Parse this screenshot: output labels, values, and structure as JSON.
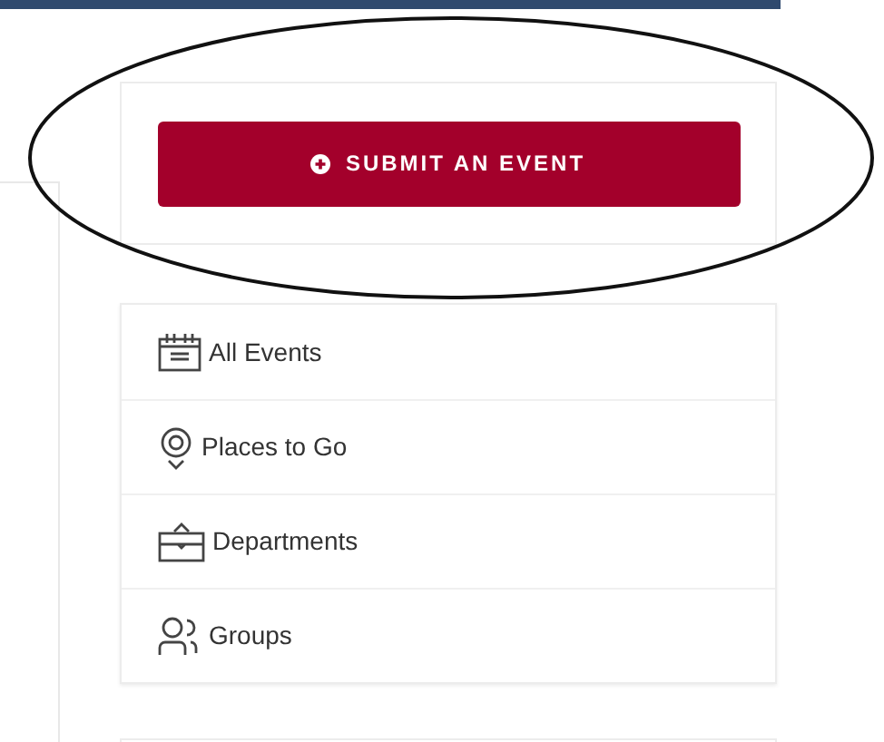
{
  "submit_button": {
    "label": "SUBMIT AN EVENT"
  },
  "nav_items": [
    {
      "label": "All Events"
    },
    {
      "label": "Places to Go"
    },
    {
      "label": "Departments"
    },
    {
      "label": "Groups"
    }
  ]
}
